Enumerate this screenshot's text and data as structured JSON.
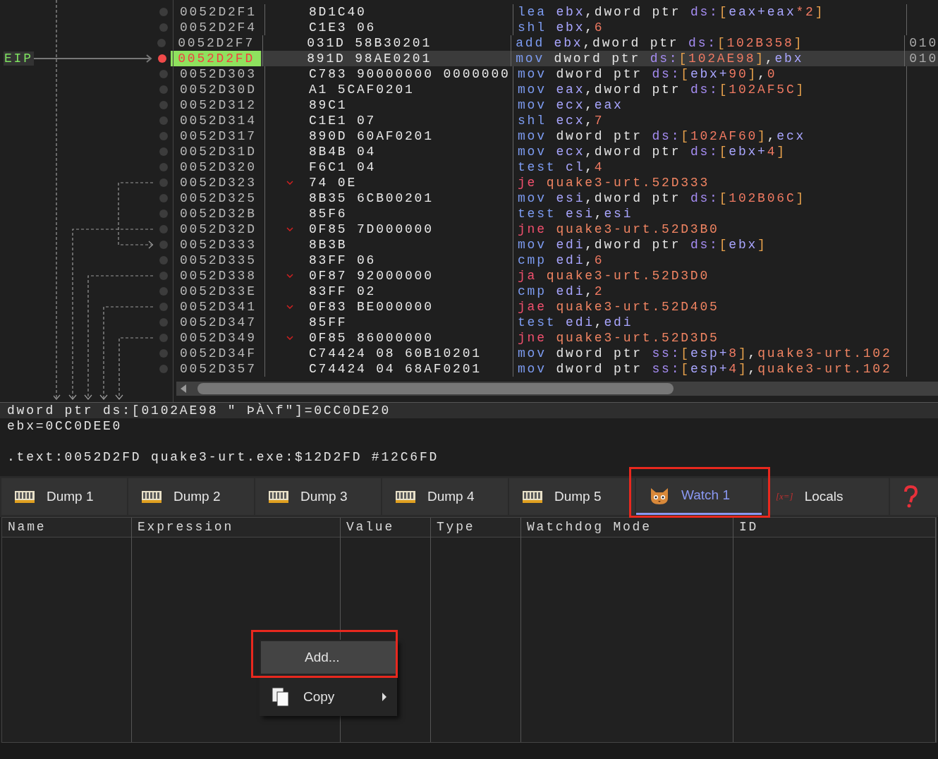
{
  "disassembly": {
    "eip_label": "EIP",
    "rows": [
      {
        "address": "0052D2F1",
        "bytes": "8D1C40",
        "jump": false,
        "selected": false,
        "mnemonic": "lea",
        "operands": [
          {
            "text": "ebx",
            "kind": "reg"
          },
          {
            "text": ",",
            "kind": "punct"
          },
          {
            "text": "dword ptr ",
            "kind": "ptr"
          },
          {
            "text": "ds:",
            "kind": "seg"
          },
          {
            "text": "[",
            "kind": "bracket"
          },
          {
            "text": "eax+eax",
            "kind": "reg"
          },
          {
            "text": "*2",
            "kind": "num"
          },
          {
            "text": "]",
            "kind": "bracket"
          }
        ]
      },
      {
        "address": "0052D2F4",
        "bytes": "C1E3 06",
        "jump": false,
        "selected": false,
        "mnemonic": "shl",
        "operands": [
          {
            "text": "ebx",
            "kind": "reg"
          },
          {
            "text": ",",
            "kind": "punct"
          },
          {
            "text": "6",
            "kind": "num"
          }
        ]
      },
      {
        "address": "0052D2F7",
        "bytes": "031D 58B30201",
        "jump": false,
        "selected": false,
        "mnemonic": "add",
        "operands": [
          {
            "text": "ebx",
            "kind": "reg"
          },
          {
            "text": ",",
            "kind": "punct"
          },
          {
            "text": "dword ptr ",
            "kind": "ptr"
          },
          {
            "text": "ds:",
            "kind": "seg"
          },
          {
            "text": "[",
            "kind": "bracket"
          },
          {
            "text": "102B358",
            "kind": "num"
          },
          {
            "text": "]",
            "kind": "bracket"
          }
        ],
        "comment": "010"
      },
      {
        "address": "0052D2FD",
        "bytes": "891D 98AE0201",
        "jump": false,
        "selected": true,
        "mnemonic": "mov",
        "operands": [
          {
            "text": "dword ptr ",
            "kind": "ptr"
          },
          {
            "text": "ds:",
            "kind": "seg"
          },
          {
            "text": "[",
            "kind": "bracket"
          },
          {
            "text": "102AE98",
            "kind": "num"
          },
          {
            "text": "]",
            "kind": "bracket"
          },
          {
            "text": ",",
            "kind": "punct"
          },
          {
            "text": "ebx",
            "kind": "reg"
          }
        ],
        "comment": "010"
      },
      {
        "address": "0052D303",
        "bytes": "C783 90000000 0000000",
        "jump": false,
        "selected": false,
        "mnemonic": "mov",
        "operands": [
          {
            "text": "dword ptr ",
            "kind": "ptr"
          },
          {
            "text": "ds:",
            "kind": "seg"
          },
          {
            "text": "[",
            "kind": "bracket"
          },
          {
            "text": "ebx+",
            "kind": "reg"
          },
          {
            "text": "90",
            "kind": "num"
          },
          {
            "text": "]",
            "kind": "bracket"
          },
          {
            "text": ",",
            "kind": "punct"
          },
          {
            "text": "0",
            "kind": "num"
          }
        ]
      },
      {
        "address": "0052D30D",
        "bytes": "A1 5CAF0201",
        "jump": false,
        "selected": false,
        "mnemonic": "mov",
        "operands": [
          {
            "text": "eax",
            "kind": "reg"
          },
          {
            "text": ",",
            "kind": "punct"
          },
          {
            "text": "dword ptr ",
            "kind": "ptr"
          },
          {
            "text": "ds:",
            "kind": "seg"
          },
          {
            "text": "[",
            "kind": "bracket"
          },
          {
            "text": "102AF5C",
            "kind": "num"
          },
          {
            "text": "]",
            "kind": "bracket"
          }
        ]
      },
      {
        "address": "0052D312",
        "bytes": "89C1",
        "jump": false,
        "selected": false,
        "mnemonic": "mov",
        "operands": [
          {
            "text": "ecx",
            "kind": "reg"
          },
          {
            "text": ",",
            "kind": "punct"
          },
          {
            "text": "eax",
            "kind": "reg"
          }
        ]
      },
      {
        "address": "0052D314",
        "bytes": "C1E1 07",
        "jump": false,
        "selected": false,
        "mnemonic": "shl",
        "operands": [
          {
            "text": "ecx",
            "kind": "reg"
          },
          {
            "text": ",",
            "kind": "punct"
          },
          {
            "text": "7",
            "kind": "num"
          }
        ]
      },
      {
        "address": "0052D317",
        "bytes": "890D 60AF0201",
        "jump": false,
        "selected": false,
        "mnemonic": "mov",
        "operands": [
          {
            "text": "dword ptr ",
            "kind": "ptr"
          },
          {
            "text": "ds:",
            "kind": "seg"
          },
          {
            "text": "[",
            "kind": "bracket"
          },
          {
            "text": "102AF60",
            "kind": "num"
          },
          {
            "text": "]",
            "kind": "bracket"
          },
          {
            "text": ",",
            "kind": "punct"
          },
          {
            "text": "ecx",
            "kind": "reg"
          }
        ]
      },
      {
        "address": "0052D31D",
        "bytes": "8B4B 04",
        "jump": false,
        "selected": false,
        "mnemonic": "mov",
        "operands": [
          {
            "text": "ecx",
            "kind": "reg"
          },
          {
            "text": ",",
            "kind": "punct"
          },
          {
            "text": "dword ptr ",
            "kind": "ptr"
          },
          {
            "text": "ds:",
            "kind": "seg"
          },
          {
            "text": "[",
            "kind": "bracket"
          },
          {
            "text": "ebx+",
            "kind": "reg"
          },
          {
            "text": "4",
            "kind": "num"
          },
          {
            "text": "]",
            "kind": "bracket"
          }
        ]
      },
      {
        "address": "0052D320",
        "bytes": "F6C1 04",
        "jump": false,
        "selected": false,
        "mnemonic": "test",
        "operands": [
          {
            "text": "cl",
            "kind": "reg"
          },
          {
            "text": ",",
            "kind": "punct"
          },
          {
            "text": "4",
            "kind": "num"
          }
        ]
      },
      {
        "address": "0052D323",
        "bytes": "74 0E",
        "jump": true,
        "selected": false,
        "mnemonic": "je",
        "operands": [
          {
            "text": "quake3-urt.52D333",
            "kind": "sym"
          }
        ]
      },
      {
        "address": "0052D325",
        "bytes": "8B35 6CB00201",
        "jump": false,
        "selected": false,
        "mnemonic": "mov",
        "operands": [
          {
            "text": "esi",
            "kind": "reg"
          },
          {
            "text": ",",
            "kind": "punct"
          },
          {
            "text": "dword ptr ",
            "kind": "ptr"
          },
          {
            "text": "ds:",
            "kind": "seg"
          },
          {
            "text": "[",
            "kind": "bracket"
          },
          {
            "text": "102B06C",
            "kind": "num"
          },
          {
            "text": "]",
            "kind": "bracket"
          }
        ]
      },
      {
        "address": "0052D32B",
        "bytes": "85F6",
        "jump": false,
        "selected": false,
        "mnemonic": "test",
        "operands": [
          {
            "text": "esi",
            "kind": "reg"
          },
          {
            "text": ",",
            "kind": "punct"
          },
          {
            "text": "esi",
            "kind": "reg"
          }
        ]
      },
      {
        "address": "0052D32D",
        "bytes": "0F85 7D000000",
        "jump": true,
        "selected": false,
        "mnemonic": "jne",
        "operands": [
          {
            "text": "quake3-urt.52D3B0",
            "kind": "sym"
          }
        ]
      },
      {
        "address": "0052D333",
        "bytes": "8B3B",
        "jump": false,
        "selected": false,
        "mnemonic": "mov",
        "operands": [
          {
            "text": "edi",
            "kind": "reg"
          },
          {
            "text": ",",
            "kind": "punct"
          },
          {
            "text": "dword ptr ",
            "kind": "ptr"
          },
          {
            "text": "ds:",
            "kind": "seg"
          },
          {
            "text": "[",
            "kind": "bracket"
          },
          {
            "text": "ebx",
            "kind": "reg"
          },
          {
            "text": "]",
            "kind": "bracket"
          }
        ]
      },
      {
        "address": "0052D335",
        "bytes": "83FF 06",
        "jump": false,
        "selected": false,
        "mnemonic": "cmp",
        "operands": [
          {
            "text": "edi",
            "kind": "reg"
          },
          {
            "text": ",",
            "kind": "punct"
          },
          {
            "text": "6",
            "kind": "num"
          }
        ]
      },
      {
        "address": "0052D338",
        "bytes": "0F87 92000000",
        "jump": true,
        "selected": false,
        "mnemonic": "ja",
        "operands": [
          {
            "text": "quake3-urt.52D3D0",
            "kind": "sym"
          }
        ]
      },
      {
        "address": "0052D33E",
        "bytes": "83FF 02",
        "jump": false,
        "selected": false,
        "mnemonic": "cmp",
        "operands": [
          {
            "text": "edi",
            "kind": "reg"
          },
          {
            "text": ",",
            "kind": "punct"
          },
          {
            "text": "2",
            "kind": "num"
          }
        ]
      },
      {
        "address": "0052D341",
        "bytes": "0F83 BE000000",
        "jump": true,
        "selected": false,
        "mnemonic": "jae",
        "operands": [
          {
            "text": "quake3-urt.52D405",
            "kind": "sym"
          }
        ]
      },
      {
        "address": "0052D347",
        "bytes": "85FF",
        "jump": false,
        "selected": false,
        "mnemonic": "test",
        "operands": [
          {
            "text": "edi",
            "kind": "reg"
          },
          {
            "text": ",",
            "kind": "punct"
          },
          {
            "text": "edi",
            "kind": "reg"
          }
        ]
      },
      {
        "address": "0052D349",
        "bytes": "0F85 86000000",
        "jump": true,
        "selected": false,
        "mnemonic": "jne",
        "operands": [
          {
            "text": "quake3-urt.52D3D5",
            "kind": "sym"
          }
        ]
      },
      {
        "address": "0052D34F",
        "bytes": "C74424 08 60B10201",
        "jump": false,
        "selected": false,
        "mnemonic": "mov",
        "operands": [
          {
            "text": "dword ptr ",
            "kind": "ptr"
          },
          {
            "text": "ss:",
            "kind": "seg"
          },
          {
            "text": "[",
            "kind": "bracket"
          },
          {
            "text": "esp+",
            "kind": "reg"
          },
          {
            "text": "8",
            "kind": "num"
          },
          {
            "text": "]",
            "kind": "bracket"
          },
          {
            "text": ",",
            "kind": "punct"
          },
          {
            "text": "quake3-urt.102",
            "kind": "sym"
          }
        ]
      },
      {
        "address": "0052D357",
        "bytes": "C74424 04 68AF0201",
        "jump": false,
        "selected": false,
        "mnemonic": "mov",
        "operands": [
          {
            "text": "dword ptr ",
            "kind": "ptr"
          },
          {
            "text": "ss:",
            "kind": "seg"
          },
          {
            "text": "[",
            "kind": "bracket"
          },
          {
            "text": "esp+",
            "kind": "reg"
          },
          {
            "text": "4",
            "kind": "num"
          },
          {
            "text": "]",
            "kind": "bracket"
          },
          {
            "text": ",",
            "kind": "punct"
          },
          {
            "text": "quake3-urt.102",
            "kind": "sym"
          }
        ]
      }
    ]
  },
  "info_panel": {
    "lines": [
      "dword ptr ds:[0102AE98 \" ÞÀ\\f\"]=0CC0DE20",
      "ebx=0CC0DEE0",
      ".text:0052D2FD quake3-urt.exe:$12D2FD #12C6FD"
    ]
  },
  "tabs": [
    {
      "label": "Dump 1",
      "kind": "dump",
      "selected": false
    },
    {
      "label": "Dump 2",
      "kind": "dump",
      "selected": false
    },
    {
      "label": "Dump 3",
      "kind": "dump",
      "selected": false
    },
    {
      "label": "Dump 4",
      "kind": "dump",
      "selected": false
    },
    {
      "label": "Dump 5",
      "kind": "dump",
      "selected": false
    },
    {
      "label": "Watch 1",
      "kind": "watch",
      "selected": true
    },
    {
      "label": "Locals",
      "kind": "locals",
      "selected": false,
      "icon_text": "[x=]"
    },
    {
      "kind": "help",
      "selected": false
    }
  ],
  "watch_table": {
    "columns": [
      "Name",
      "Expression",
      "Value",
      "Type",
      "Watchdog Mode",
      "ID"
    ]
  },
  "context_menu": {
    "items": [
      {
        "label": "Add...",
        "kind": "plain",
        "selected": true
      },
      {
        "label": "Copy",
        "kind": "submenu",
        "selected": false
      }
    ]
  }
}
